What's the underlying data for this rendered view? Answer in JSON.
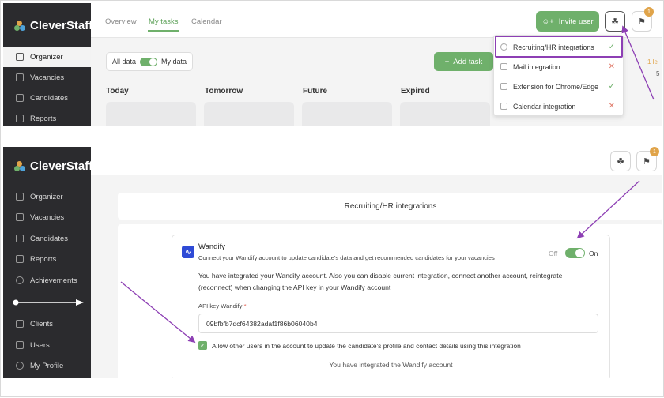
{
  "app": {
    "name": "CleverStaff"
  },
  "top": {
    "sidebar": [
      {
        "label": "Organizer",
        "active": true
      },
      {
        "label": "Vacancies"
      },
      {
        "label": "Candidates"
      },
      {
        "label": "Reports"
      }
    ],
    "tabs": [
      {
        "label": "Overview"
      },
      {
        "label": "My tasks",
        "active": true
      },
      {
        "label": "Calendar"
      }
    ],
    "invite_label": "Invite user",
    "notification_count": "1",
    "filter": {
      "all": "All data",
      "mine": "My data"
    },
    "add_task_label": "Add task",
    "columns": [
      "Today",
      "Tomorrow",
      "Future",
      "Expired"
    ],
    "edge_text": {
      "first": "1 le",
      "second": "5"
    },
    "dropdown": [
      {
        "label": "Recruiting/HR integrations",
        "status": "ok"
      },
      {
        "label": "Mail integration",
        "status": "no"
      },
      {
        "label": "Extension for Chrome/Edge",
        "status": "ok"
      },
      {
        "label": "Calendar integration",
        "status": "no"
      }
    ]
  },
  "bottom": {
    "sidebar": [
      {
        "label": "Organizer"
      },
      {
        "label": "Vacancies"
      },
      {
        "label": "Candidates"
      },
      {
        "label": "Reports"
      },
      {
        "label": "Achievements"
      },
      {
        "label": "Clients"
      },
      {
        "label": "Users"
      },
      {
        "label": "My Profile"
      }
    ],
    "notification_count": "1",
    "page_title": "Recruiting/HR integrations",
    "integration": {
      "name": "Wandify",
      "description": "Connect your Wandify account to update candidate's data and get recommended candidates for your vacancies",
      "off_label": "Off",
      "on_label": "On",
      "info": "You have integrated your Wandify account. Also you can disable current integration, connect another account, reintegrate (reconnect) when changing the API key in your Wandify account",
      "api_label": "API key Wandify",
      "api_required": "*",
      "api_key": "09bfbfb7dcf64382adaf1f86b06040b4",
      "checkbox_label": "Allow other users in the account to update the candidate's profile and contact details using this integration",
      "footer": "You have integrated the Wandify account"
    }
  },
  "colors": {
    "accent": "#6fb06b",
    "sidebar": "#2b2b2e",
    "highlight": "#8d3fb4",
    "badge": "#e0a44a",
    "error": "#e07a6a"
  },
  "icons": {
    "invite": "add-user-icon",
    "puzzle": "puzzle-icon",
    "bell": "bell-icon",
    "plus": "plus-icon",
    "check": "check-icon",
    "cross": "cross-icon"
  }
}
